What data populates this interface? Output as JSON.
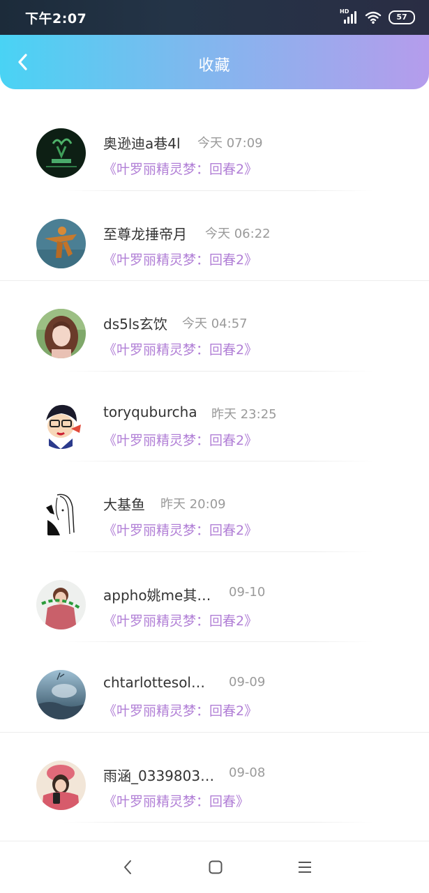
{
  "status_bar": {
    "time": "下午2:07",
    "signal_badge": "HD",
    "battery": "57"
  },
  "header": {
    "title": "收藏"
  },
  "items": [
    {
      "name": "奥逊迪a巷4l",
      "time": "今天 07:09",
      "title": "《叶罗丽精灵梦：回春2》"
    },
    {
      "name": "至尊龙捶帝月",
      "time": "今天 06:22",
      "title": "《叶罗丽精灵梦：回春2》"
    },
    {
      "name": "ds5ls玄饮",
      "time": "今天 04:57",
      "title": "《叶罗丽精灵梦：回春2》"
    },
    {
      "name": "toryquburcha",
      "time": "昨天 23:25",
      "title": "《叶罗丽精灵梦：回春2》"
    },
    {
      "name": "大基鱼",
      "time": "昨天 20:09",
      "title": "《叶罗丽精灵梦：回春2》"
    },
    {
      "name": "appho姚me其…",
      "time": "09-10",
      "title": "《叶罗丽精灵梦：回春2》"
    },
    {
      "name": "chtarlottesol…",
      "time": "09-09",
      "title": "《叶罗丽精灵梦：回春2》"
    },
    {
      "name": "雨涵_0339803…",
      "time": "09-08",
      "title": "《叶罗丽精灵梦：回春》"
    }
  ],
  "colors": {
    "accent_purple": "#b17fd6",
    "header_start": "#49d3f4",
    "header_end": "#b59cec"
  }
}
